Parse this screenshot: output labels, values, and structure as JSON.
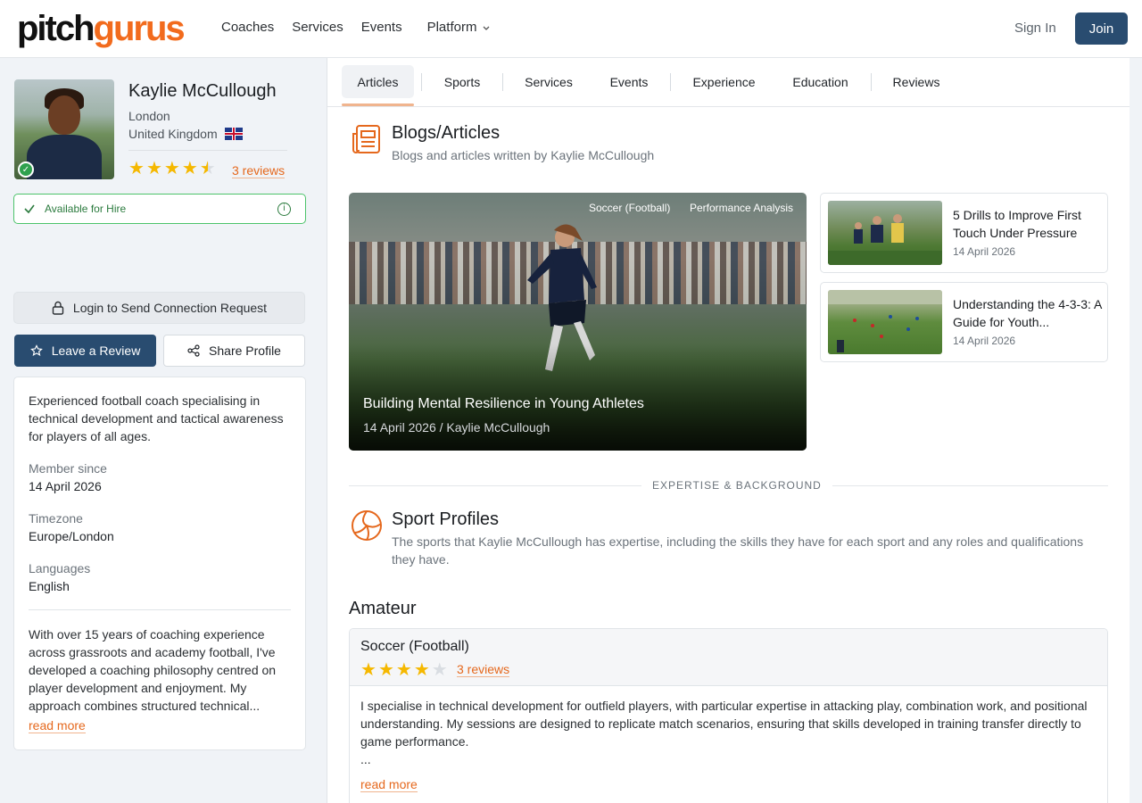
{
  "brand": {
    "part1": "pitch",
    "part2": "gurus"
  },
  "nav": {
    "coaches": "Coaches",
    "services": "Services",
    "events": "Events",
    "platform": "Platform",
    "signin": "Sign In",
    "join": "Join"
  },
  "profile": {
    "name": "Kaylie McCullough",
    "city": "London",
    "country": "United Kingdom",
    "rating": 4.5,
    "reviews": "3 reviews",
    "availability": "Available for Hire",
    "login_button": "Login to Send Connection Request",
    "leave_review": "Leave a Review",
    "share_profile": "Share Profile",
    "intro": "Experienced football coach specialising in technical development and tactical awareness for players of all ages.",
    "member_since_label": "Member since",
    "member_since": "14 April 2026",
    "timezone_label": "Timezone",
    "timezone": "Europe/London",
    "languages_label": "Languages",
    "languages": "English",
    "bio": "With over 15 years of coaching experience across grassroots and academy football, I've developed a coaching philosophy centred on player development and enjoyment. My approach combines structured technical...",
    "read_more": "read more"
  },
  "tabs": [
    "Articles",
    "Sports",
    "Services",
    "Events",
    "Experience",
    "Education",
    "Reviews"
  ],
  "articles": {
    "title": "Blogs/Articles",
    "subtitle": "Blogs and articles written by Kaylie McCullough",
    "featured": {
      "tags": [
        "Soccer (Football)",
        "Performance Analysis"
      ],
      "title": "Building Mental Resilience in Young Athletes",
      "meta": "14 April 2026 / Kaylie McCullough"
    },
    "list": [
      {
        "title": "5 Drills to Improve First Touch Under Pressure",
        "date": "14 April 2026"
      },
      {
        "title": "Understanding the 4-3-3: A Guide for Youth...",
        "date": "14 April 2026"
      }
    ]
  },
  "divider": "EXPERTISE & BACKGROUND",
  "sports": {
    "title": "Sport Profiles",
    "subtitle": "The sports that Kaylie McCullough has expertise, including the skills they have for each sport and any roles and qualifications they have.",
    "level": "Amateur",
    "sport_name": "Soccer (Football)",
    "sport_rating": 4,
    "sport_reviews": "3 reviews",
    "description": "I specialise in technical development for outfield players, with particular expertise in attacking play, combination work, and positional understanding. My sessions are designed to replicate match scenarios, ensuring that skills developed in training transfer directly to game performance.",
    "ellipsis": "...",
    "read_more": "read more"
  }
}
